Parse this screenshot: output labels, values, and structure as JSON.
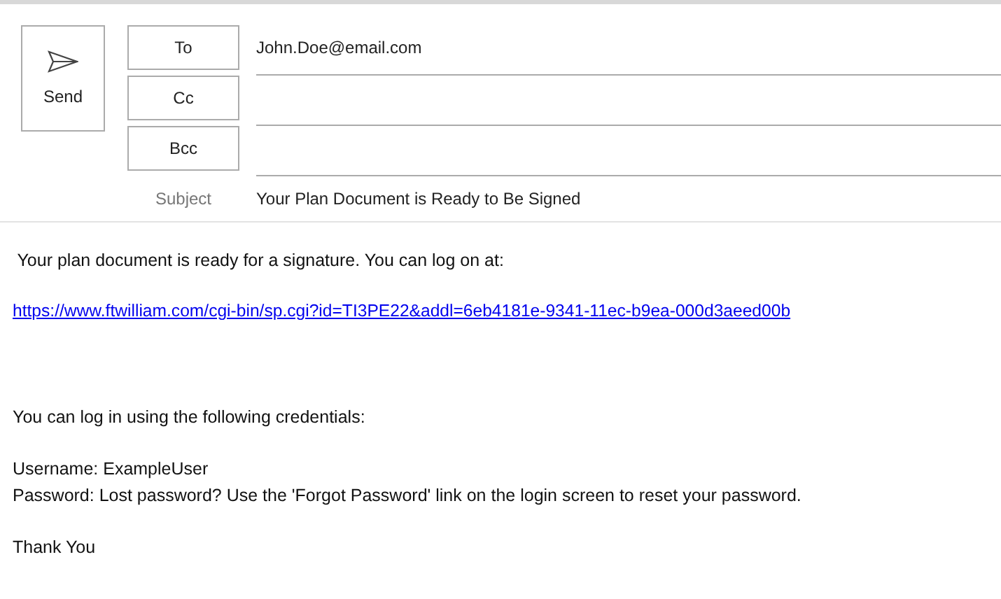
{
  "send_button": {
    "label": "Send"
  },
  "recipients": [
    {
      "label": "To",
      "value": "John.Doe@email.com"
    },
    {
      "label": "Cc"
    },
    {
      "label": "Bcc"
    }
  ],
  "subject": {
    "label": "Subject",
    "value": "Your Plan Document is Ready to Be Signed"
  },
  "body": [
    {
      "kind": "text",
      "text": " Your plan document is ready for a signature. You can log on at:"
    },
    {
      "kind": "link",
      "text": "https://www.ftwilliam.com/cgi-bin/sp.cgi?id=TI3PE22&addl=6eb4181e-9341-11ec-b9ea-000d3aeed00b"
    },
    {
      "kind": "gap"
    },
    {
      "kind": "text",
      "text": "You can log in using the following credentials:"
    },
    {
      "kind": "gap_small"
    },
    {
      "kind": "text",
      "text": "Username: ExampleUser"
    },
    {
      "kind": "text",
      "text": "Password: Lost password? Use the 'Forgot Password' link on the login screen to reset your password."
    },
    {
      "kind": "gap_small"
    },
    {
      "kind": "text",
      "text": "Thank You"
    }
  ]
}
